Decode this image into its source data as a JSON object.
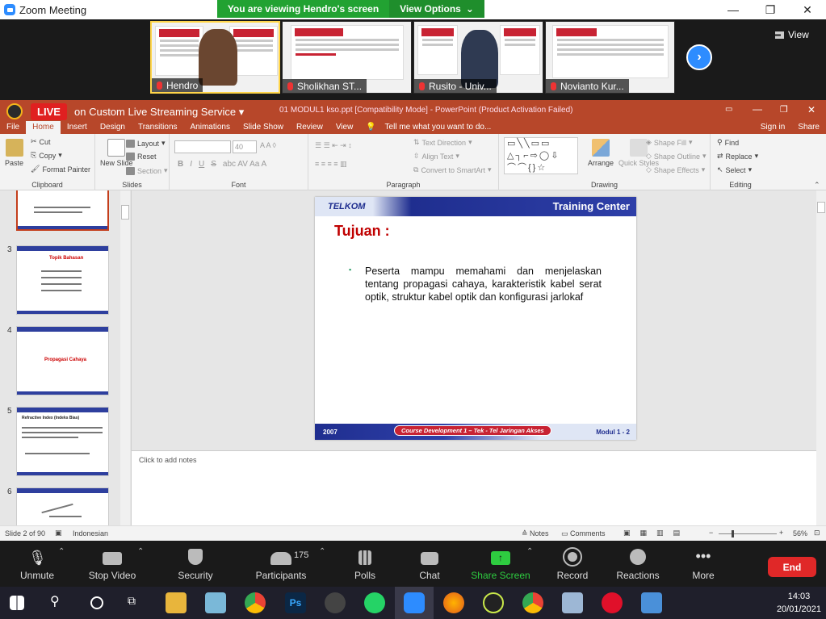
{
  "zoom": {
    "title": "Zoom Meeting",
    "viewing_banner": "You are viewing Hendro's screen",
    "view_options": "View Options",
    "view_label": "View",
    "participants": [
      {
        "name": "Hendro",
        "active": true
      },
      {
        "name": "Sholikhan ST..."
      },
      {
        "name": "Rusito - Univ..."
      },
      {
        "name": "Novianto Kur..."
      }
    ],
    "toolbar": {
      "unmute": "Unmute",
      "stop_video": "Stop Video",
      "security": "Security",
      "participants": "Participants",
      "participants_count": "175",
      "polls": "Polls",
      "chat": "Chat",
      "share_screen": "Share Screen",
      "record": "Record",
      "reactions": "Reactions",
      "more": "More",
      "end": "End"
    }
  },
  "live": {
    "badge": "LIVE",
    "title": "on Custom Live Streaming Service"
  },
  "ppt": {
    "doc_title": "01 MODUL1 kso.ppt [Compatibility Mode] - PowerPoint (Product Activation Failed)",
    "tabs": [
      "File",
      "Home",
      "Insert",
      "Design",
      "Transitions",
      "Animations",
      "Slide Show",
      "Review",
      "View"
    ],
    "tell_me": "Tell me what you want to do...",
    "sign_in": "Sign in",
    "share": "Share",
    "ribbon": {
      "paste": "Paste",
      "cut": "Cut",
      "copy": "Copy",
      "format_painter": "Format Painter",
      "clipboard": "Clipboard",
      "new_slide": "New Slide",
      "layout": "Layout",
      "reset": "Reset",
      "section": "Section",
      "slides": "Slides",
      "font_size": "40",
      "font": "Font",
      "text_direction": "Text Direction",
      "align_text": "Align Text",
      "convert_smartart": "Convert to SmartArt",
      "paragraph": "Paragraph",
      "arrange": "Arrange",
      "quick_styles": "Quick Styles",
      "shape_fill": "Shape Fill",
      "shape_outline": "Shape Outline",
      "shape_effects": "Shape Effects",
      "drawing": "Drawing",
      "find": "Find",
      "replace": "Replace",
      "select": "Select",
      "editing": "Editing"
    },
    "thumbnails": [
      {
        "num": "3",
        "title": "Topik Bahasan",
        "brand": "Training Center"
      },
      {
        "num": "4",
        "title": "Propagasi Cahaya",
        "brand": "Training Center"
      },
      {
        "num": "5",
        "title": "Refractive Index (Indeks Bias)",
        "brand": "Training Center"
      },
      {
        "num": "6",
        "title": "",
        "brand": "Training Center"
      }
    ],
    "slide": {
      "brand_left": "TELKOM",
      "brand_right": "Training Center",
      "heading": "Tujuan :",
      "bullet": "Peserta mampu memahami dan menjelaskan tentang propagasi cahaya, karakteristik kabel serat optik, struktur kabel optik dan konfigurasi jarlokaf",
      "footer_year": "2007",
      "footer_course": "Course Development 1 – Tek - Tel Jaringan Akses",
      "footer_module": "Modul 1 - 2"
    },
    "notes_placeholder": "Click to add notes",
    "status": {
      "slide_info": "Slide 2 of 90",
      "language": "Indonesian",
      "notes": "Notes",
      "comments": "Comments",
      "zoom": "56%"
    }
  },
  "taskbar": {
    "time": "14:03",
    "date": "20/01/2021"
  },
  "colors": {
    "ppt_accent": "#b7472a",
    "zoom_green": "#22a232",
    "zoom_blue": "#2d8cff",
    "end_red": "#e02828"
  }
}
